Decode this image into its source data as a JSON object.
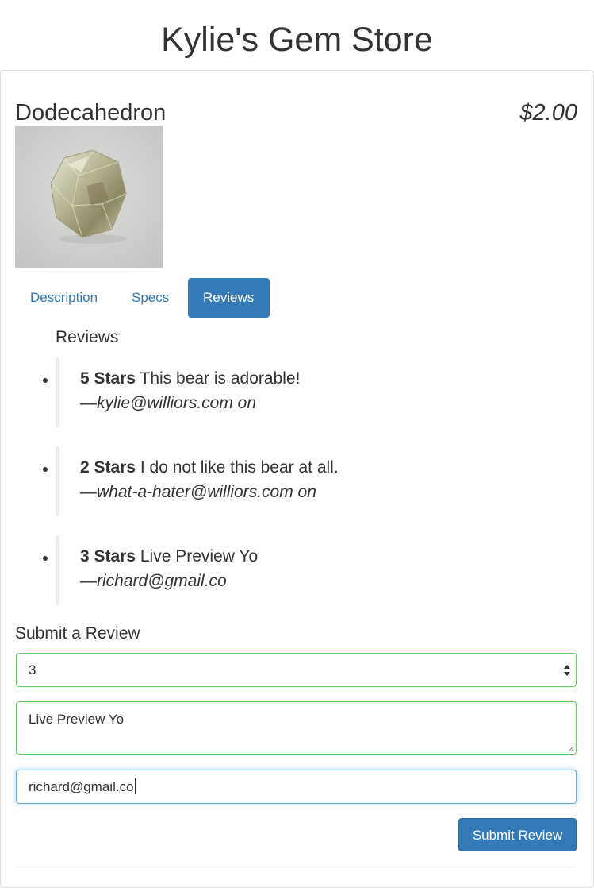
{
  "store": {
    "title": "Kylie's Gem Store"
  },
  "product": {
    "name": "Dodecahedron",
    "price": "$2.00",
    "image_alt": "gem-photo"
  },
  "tabs": [
    {
      "label": "Description",
      "active": false
    },
    {
      "label": "Specs",
      "active": false
    },
    {
      "label": "Reviews",
      "active": true
    }
  ],
  "reviews": {
    "heading": "Reviews",
    "items": [
      {
        "stars": "5 Stars",
        "body": " This bear is adorable!",
        "author": "—kylie@williors.com on"
      },
      {
        "stars": "2 Stars",
        "body": " I do not like this bear at all.",
        "author": "—what-a-hater@williors.com on"
      },
      {
        "stars": "3 Stars",
        "body": " Live Preview Yo",
        "author": "—richard@gmail.co"
      }
    ]
  },
  "form": {
    "heading": "Submit a Review",
    "rating_value": "3",
    "body_value": "Live Preview Yo",
    "email_value": "richard@gmail.co",
    "submit_label": "Submit Review"
  },
  "colors": {
    "primary": "#337ab7",
    "valid_border": "#5fd05f",
    "focus_border": "#66afe9",
    "text": "#333333"
  }
}
